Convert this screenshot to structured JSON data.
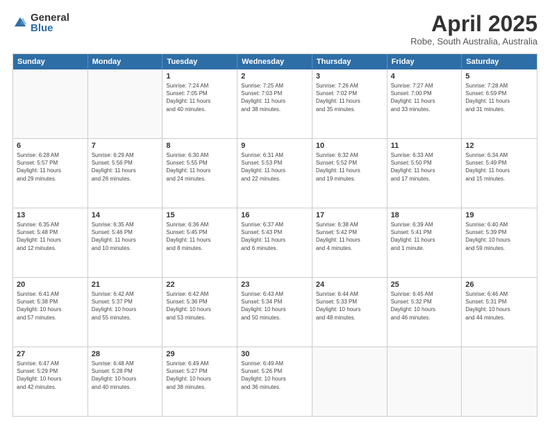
{
  "logo": {
    "general": "General",
    "blue": "Blue"
  },
  "title": "April 2025",
  "subtitle": "Robe, South Australia, Australia",
  "header_days": [
    "Sunday",
    "Monday",
    "Tuesday",
    "Wednesday",
    "Thursday",
    "Friday",
    "Saturday"
  ],
  "rows": [
    [
      {
        "day": "",
        "lines": [],
        "empty": true
      },
      {
        "day": "",
        "lines": [],
        "empty": true
      },
      {
        "day": "1",
        "lines": [
          "Sunrise: 7:24 AM",
          "Sunset: 7:05 PM",
          "Daylight: 11 hours",
          "and 40 minutes."
        ]
      },
      {
        "day": "2",
        "lines": [
          "Sunrise: 7:25 AM",
          "Sunset: 7:03 PM",
          "Daylight: 11 hours",
          "and 38 minutes."
        ]
      },
      {
        "day": "3",
        "lines": [
          "Sunrise: 7:26 AM",
          "Sunset: 7:02 PM",
          "Daylight: 11 hours",
          "and 35 minutes."
        ]
      },
      {
        "day": "4",
        "lines": [
          "Sunrise: 7:27 AM",
          "Sunset: 7:00 PM",
          "Daylight: 11 hours",
          "and 33 minutes."
        ]
      },
      {
        "day": "5",
        "lines": [
          "Sunrise: 7:28 AM",
          "Sunset: 6:59 PM",
          "Daylight: 11 hours",
          "and 31 minutes."
        ]
      }
    ],
    [
      {
        "day": "6",
        "lines": [
          "Sunrise: 6:28 AM",
          "Sunset: 5:57 PM",
          "Daylight: 11 hours",
          "and 29 minutes."
        ]
      },
      {
        "day": "7",
        "lines": [
          "Sunrise: 6:29 AM",
          "Sunset: 5:56 PM",
          "Daylight: 11 hours",
          "and 26 minutes."
        ]
      },
      {
        "day": "8",
        "lines": [
          "Sunrise: 6:30 AM",
          "Sunset: 5:55 PM",
          "Daylight: 11 hours",
          "and 24 minutes."
        ]
      },
      {
        "day": "9",
        "lines": [
          "Sunrise: 6:31 AM",
          "Sunset: 5:53 PM",
          "Daylight: 11 hours",
          "and 22 minutes."
        ]
      },
      {
        "day": "10",
        "lines": [
          "Sunrise: 6:32 AM",
          "Sunset: 5:52 PM",
          "Daylight: 11 hours",
          "and 19 minutes."
        ]
      },
      {
        "day": "11",
        "lines": [
          "Sunrise: 6:33 AM",
          "Sunset: 5:50 PM",
          "Daylight: 11 hours",
          "and 17 minutes."
        ]
      },
      {
        "day": "12",
        "lines": [
          "Sunrise: 6:34 AM",
          "Sunset: 5:49 PM",
          "Daylight: 11 hours",
          "and 15 minutes."
        ]
      }
    ],
    [
      {
        "day": "13",
        "lines": [
          "Sunrise: 6:35 AM",
          "Sunset: 5:48 PM",
          "Daylight: 11 hours",
          "and 12 minutes."
        ]
      },
      {
        "day": "14",
        "lines": [
          "Sunrise: 6:35 AM",
          "Sunset: 5:46 PM",
          "Daylight: 11 hours",
          "and 10 minutes."
        ]
      },
      {
        "day": "15",
        "lines": [
          "Sunrise: 6:36 AM",
          "Sunset: 5:45 PM",
          "Daylight: 11 hours",
          "and 8 minutes."
        ]
      },
      {
        "day": "16",
        "lines": [
          "Sunrise: 6:37 AM",
          "Sunset: 5:43 PM",
          "Daylight: 11 hours",
          "and 6 minutes."
        ]
      },
      {
        "day": "17",
        "lines": [
          "Sunrise: 6:38 AM",
          "Sunset: 5:42 PM",
          "Daylight: 11 hours",
          "and 4 minutes."
        ]
      },
      {
        "day": "18",
        "lines": [
          "Sunrise: 6:39 AM",
          "Sunset: 5:41 PM",
          "Daylight: 11 hours",
          "and 1 minute."
        ]
      },
      {
        "day": "19",
        "lines": [
          "Sunrise: 6:40 AM",
          "Sunset: 5:39 PM",
          "Daylight: 10 hours",
          "and 59 minutes."
        ]
      }
    ],
    [
      {
        "day": "20",
        "lines": [
          "Sunrise: 6:41 AM",
          "Sunset: 5:38 PM",
          "Daylight: 10 hours",
          "and 57 minutes."
        ]
      },
      {
        "day": "21",
        "lines": [
          "Sunrise: 6:42 AM",
          "Sunset: 5:37 PM",
          "Daylight: 10 hours",
          "and 55 minutes."
        ]
      },
      {
        "day": "22",
        "lines": [
          "Sunrise: 6:42 AM",
          "Sunset: 5:36 PM",
          "Daylight: 10 hours",
          "and 53 minutes."
        ]
      },
      {
        "day": "23",
        "lines": [
          "Sunrise: 6:43 AM",
          "Sunset: 5:34 PM",
          "Daylight: 10 hours",
          "and 50 minutes."
        ]
      },
      {
        "day": "24",
        "lines": [
          "Sunrise: 6:44 AM",
          "Sunset: 5:33 PM",
          "Daylight: 10 hours",
          "and 48 minutes."
        ]
      },
      {
        "day": "25",
        "lines": [
          "Sunrise: 6:45 AM",
          "Sunset: 5:32 PM",
          "Daylight: 10 hours",
          "and 46 minutes."
        ]
      },
      {
        "day": "26",
        "lines": [
          "Sunrise: 6:46 AM",
          "Sunset: 5:31 PM",
          "Daylight: 10 hours",
          "and 44 minutes."
        ]
      }
    ],
    [
      {
        "day": "27",
        "lines": [
          "Sunrise: 6:47 AM",
          "Sunset: 5:29 PM",
          "Daylight: 10 hours",
          "and 42 minutes."
        ]
      },
      {
        "day": "28",
        "lines": [
          "Sunrise: 6:48 AM",
          "Sunset: 5:28 PM",
          "Daylight: 10 hours",
          "and 40 minutes."
        ]
      },
      {
        "day": "29",
        "lines": [
          "Sunrise: 6:49 AM",
          "Sunset: 5:27 PM",
          "Daylight: 10 hours",
          "and 38 minutes."
        ]
      },
      {
        "day": "30",
        "lines": [
          "Sunrise: 6:49 AM",
          "Sunset: 5:26 PM",
          "Daylight: 10 hours",
          "and 36 minutes."
        ]
      },
      {
        "day": "",
        "lines": [],
        "empty": true
      },
      {
        "day": "",
        "lines": [],
        "empty": true
      },
      {
        "day": "",
        "lines": [],
        "empty": true
      }
    ]
  ]
}
